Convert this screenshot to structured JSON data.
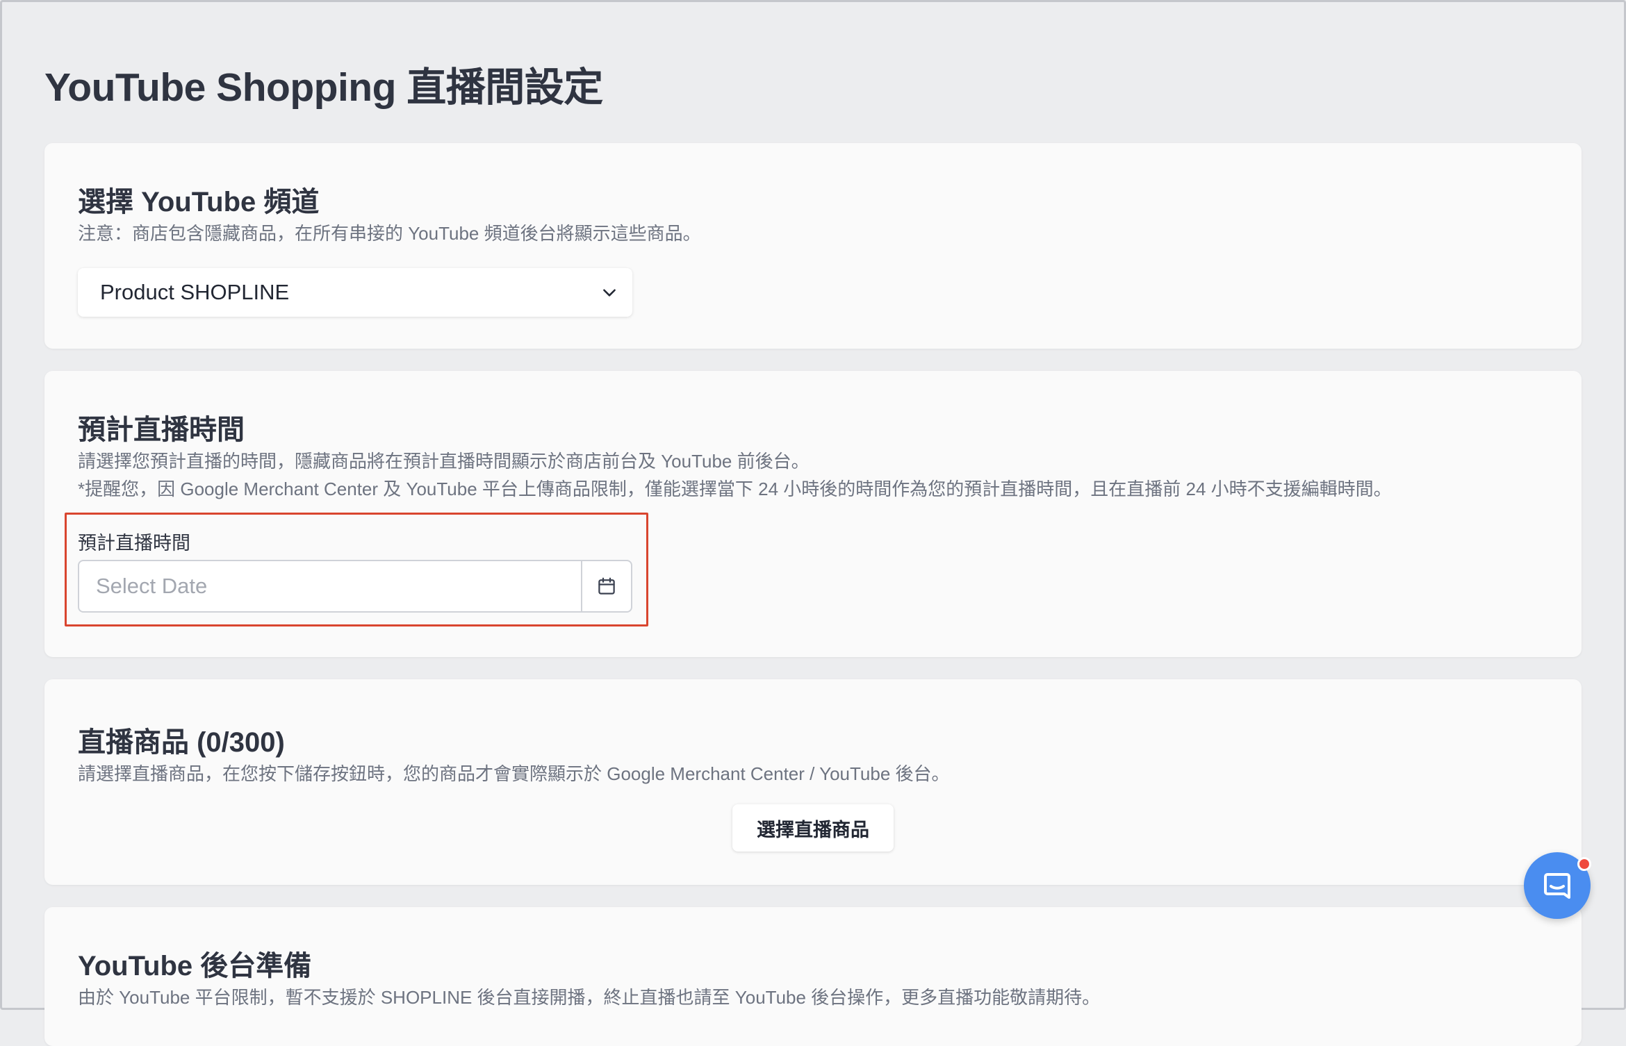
{
  "page": {
    "title": "YouTube Shopping 直播間設定"
  },
  "channel_card": {
    "title": "選擇 YouTube 頻道",
    "note": "注意：商店包含隱藏商品，在所有串接的 YouTube 頻道後台將顯示這些商品。",
    "selected_channel": "Product SHOPLINE"
  },
  "schedule_card": {
    "title": "預計直播時間",
    "desc_line1": "請選擇您預計直播的時間，隱藏商品將在預計直播時間顯示於商店前台及 YouTube 前後台。",
    "desc_line2": "*提醒您，因 Google Merchant Center 及 YouTube 平台上傳商品限制，僅能選擇當下 24 小時後的時間作為您的預計直播時間，且在直播前 24 小時不支援編輯時間。",
    "field_label": "預計直播時間",
    "date_placeholder": "Select Date",
    "date_value": ""
  },
  "products_card": {
    "title": "直播商品 (0/300)",
    "desc": "請選擇直播商品，在您按下儲存按鈕時，您的商品才會實際顯示於 Google Merchant Center / YouTube 後台。",
    "select_button": "選擇直播商品"
  },
  "backend_card": {
    "title": "YouTube 後台準備",
    "desc": "由於 YouTube 平台限制，暫不支援於 SHOPLINE 後台直接開播，終止直播也請至 YouTube 後台操作，更多直播功能敬請期待。"
  },
  "icons": {
    "select_chevron": "chevron-down-icon",
    "calendar": "calendar-icon",
    "chat": "chat-bubble-icon"
  },
  "colors": {
    "highlight": "#d9452f",
    "chat_fab": "#4a8df0",
    "notification_dot": "#ef4a3c"
  }
}
